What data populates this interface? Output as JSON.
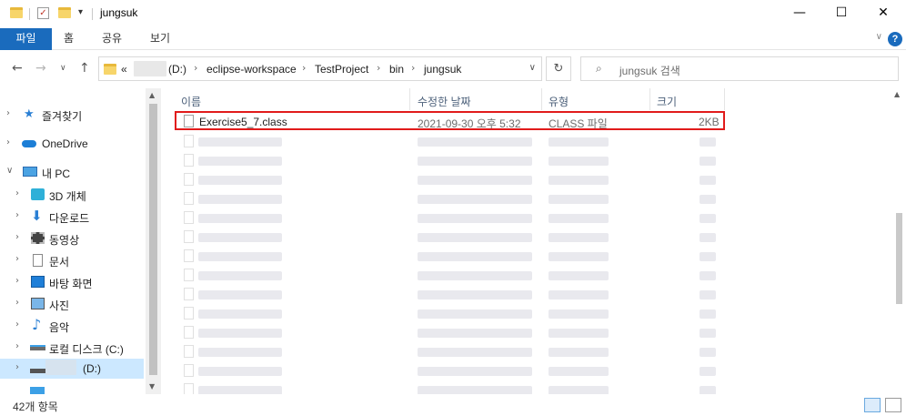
{
  "window": {
    "title": "jungsuk",
    "minimize_glyph": "—",
    "maximize_glyph": "☐",
    "close_glyph": "✕"
  },
  "ribbon": {
    "tabs": [
      "파일",
      "홈",
      "공유",
      "보기"
    ],
    "help_label": "?"
  },
  "address": {
    "prefix": "«",
    "drive": "(D:)",
    "crumbs": [
      "eclipse-workspace",
      "TestProject",
      "bin",
      "jungsuk"
    ],
    "separator": "›"
  },
  "search": {
    "placeholder": "jungsuk 검색"
  },
  "nav": {
    "items": [
      {
        "label": "즐겨찾기",
        "icon": "star-icon"
      },
      {
        "label": "OneDrive",
        "icon": "cloud-icon"
      },
      {
        "label": "내 PC",
        "icon": "pc-icon"
      },
      {
        "label": "3D 개체",
        "icon": "cube-icon"
      },
      {
        "label": "다운로드",
        "icon": "download-icon"
      },
      {
        "label": "동영상",
        "icon": "video-icon"
      },
      {
        "label": "문서",
        "icon": "document-icon"
      },
      {
        "label": "바탕 화면",
        "icon": "desktop-icon"
      },
      {
        "label": "사진",
        "icon": "picture-icon"
      },
      {
        "label": "음악",
        "icon": "music-icon"
      },
      {
        "label": "로컬 디스크 (C:)",
        "icon": "drive-icon"
      },
      {
        "label": "(D:)",
        "icon": "drive-icon"
      }
    ]
  },
  "columns": {
    "name": "이름",
    "modified": "수정한 날짜",
    "type": "유형",
    "size": "크기"
  },
  "files": [
    {
      "name": "Exercise5_7.class",
      "modified": "2021-09-30 오후 5:32",
      "type": "CLASS 파일",
      "size": "2KB"
    }
  ],
  "status": {
    "item_count": "42개 항목"
  },
  "colors": {
    "accent": "#1a6bbd",
    "highlight_border": "#e11b1b",
    "selected_nav": "#cce8ff",
    "header_text": "#4c607a"
  }
}
